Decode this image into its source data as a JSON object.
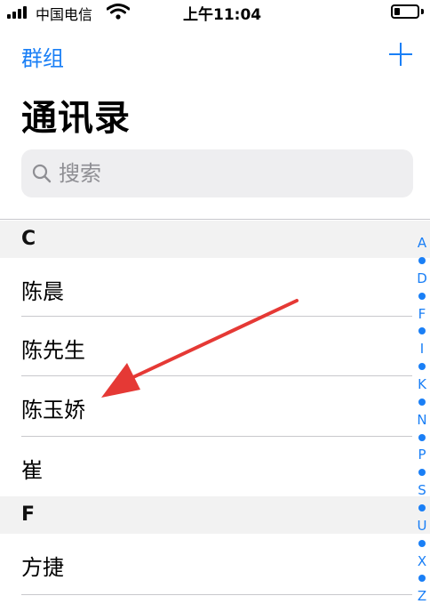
{
  "status_bar": {
    "carrier": "中国电信",
    "time": "上午11:04",
    "battery_level": 0.25
  },
  "nav": {
    "groups_label": "群组",
    "add_icon": "plus-icon"
  },
  "page_title": "通讯录",
  "search": {
    "placeholder": "搜索",
    "icon": "search-icon"
  },
  "sections": [
    {
      "letter": "C",
      "contacts": [
        "陈晨",
        "陈先生",
        "陈玉娇",
        "崔"
      ]
    },
    {
      "letter": "F",
      "contacts": [
        "方捷"
      ]
    }
  ],
  "index": [
    "A",
    "D",
    "F",
    "I",
    "K",
    "N",
    "P",
    "S",
    "U",
    "X",
    "Z"
  ],
  "colors": {
    "accent": "#1a7ff6",
    "annotation_arrow": "#e53935",
    "section_bg": "#f2f2f2",
    "search_bg": "#eeeef0"
  },
  "annotation": {
    "icon": "red-arrow-annotation",
    "points_to": "陈玉娇"
  }
}
